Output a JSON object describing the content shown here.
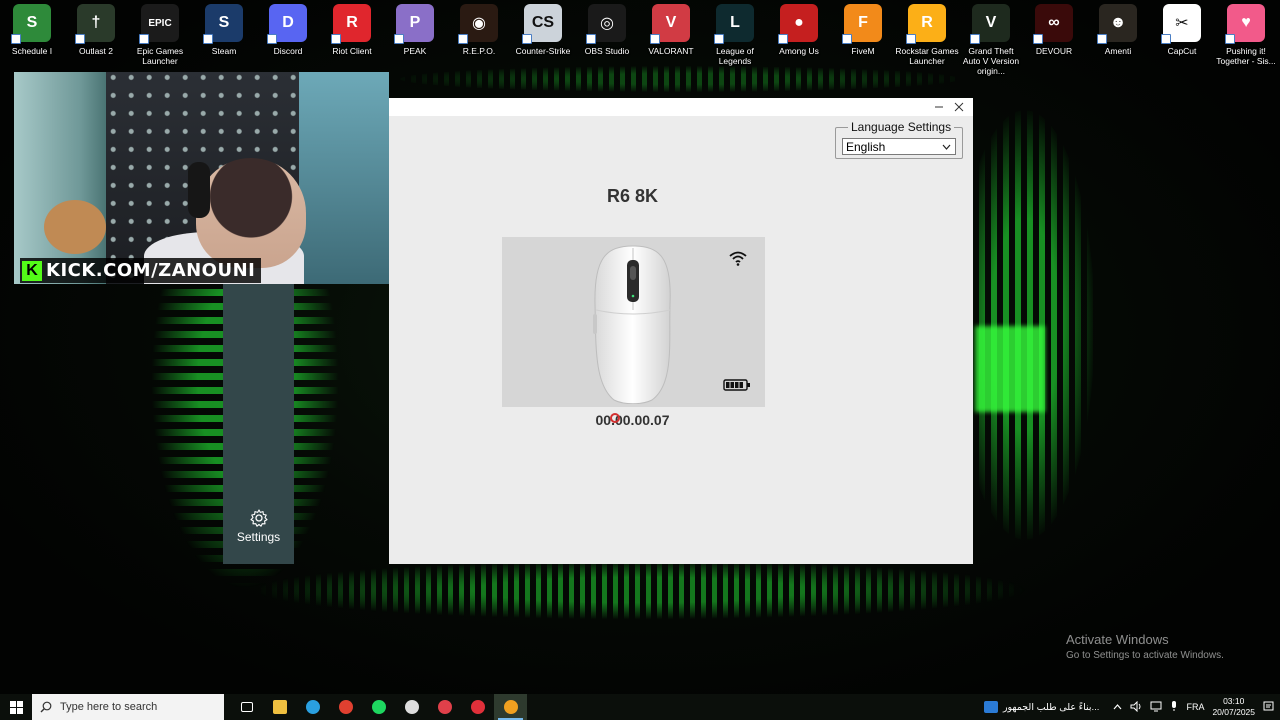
{
  "desktop": {
    "icons": [
      {
        "label": "Schedule I",
        "icon": "schedule-i-icon",
        "color": "#2e8a3a",
        "glyph": "S"
      },
      {
        "label": "Outlast 2",
        "icon": "outlast-2-icon",
        "color": "#2a3a2a",
        "glyph": "†"
      },
      {
        "label": "Epic Games Launcher",
        "icon": "epic-games-icon",
        "color": "#1b1b1b",
        "glyph": "EPIC"
      },
      {
        "label": "Steam",
        "icon": "steam-icon",
        "color": "#1b3b6a",
        "glyph": "S"
      },
      {
        "label": "Discord",
        "icon": "discord-icon",
        "color": "#5865f2",
        "glyph": "D"
      },
      {
        "label": "Riot Client",
        "icon": "riot-client-icon",
        "color": "#e0262d",
        "glyph": "R"
      },
      {
        "label": "PEAK",
        "icon": "peak-icon",
        "color": "#8a6fc8",
        "glyph": "P"
      },
      {
        "label": "R.E.P.O.",
        "icon": "repo-icon",
        "color": "#2a1a12",
        "glyph": "◉"
      },
      {
        "label": "Counter-Strike",
        "icon": "counter-strike-icon",
        "color": "#ccd3da",
        "glyph": "CS"
      },
      {
        "label": "OBS Studio",
        "icon": "obs-studio-icon",
        "color": "#1a1a1a",
        "glyph": "◎"
      },
      {
        "label": "VALORANT",
        "icon": "valorant-icon",
        "color": "#d13b44",
        "glyph": "V"
      },
      {
        "label": "League of Legends",
        "icon": "league-of-legends-icon",
        "color": "#0e2a2f",
        "glyph": "L"
      },
      {
        "label": "Among Us",
        "icon": "among-us-icon",
        "color": "#c51f1f",
        "glyph": "●"
      },
      {
        "label": "FiveM",
        "icon": "fivem-icon",
        "color": "#f28a1a",
        "glyph": "F"
      },
      {
        "label": "Rockstar Games Launcher",
        "icon": "rockstar-icon",
        "color": "#fcaf17",
        "glyph": "R"
      },
      {
        "label": "Grand Theft Auto V Version origin...",
        "icon": "gta-v-icon",
        "color": "#1e2a1e",
        "glyph": "V"
      },
      {
        "label": "DEVOUR",
        "icon": "devour-icon",
        "color": "#3a0a0a",
        "glyph": "∞"
      },
      {
        "label": "Amenti",
        "icon": "amenti-icon",
        "color": "#2a2620",
        "glyph": "☻"
      },
      {
        "label": "CapCut",
        "icon": "capcut-icon",
        "color": "#ffffff",
        "glyph": "✂"
      },
      {
        "label": "Pushing it! Together - Sis...",
        "icon": "pushing-it-icon",
        "color": "#f25a8a",
        "glyph": "♥"
      }
    ],
    "watermark": {
      "line1": "Activate Windows",
      "line2": "Go to Settings to activate Windows."
    }
  },
  "webcam": {
    "banner_text": "KICK.COM/ZANOUNI",
    "brand_color": "#53fc18"
  },
  "app": {
    "language_settings_label": "Language Settings",
    "language_value": "English",
    "device_name": "R6 8K",
    "firmware_version": "00.00.00.07",
    "sidebar_settings_label": "Settings",
    "sidebar_color": "#33474a"
  },
  "taskbar": {
    "search_placeholder": "Type here to search",
    "apps": [
      "task-view-icon",
      "file-explorer-icon",
      "edge-icon",
      "chrome-icon",
      "spotify-icon",
      "obs-icon",
      "valorant-icon",
      "riot-icon",
      "mouse-software-icon"
    ],
    "news_text": "بناءً على طلب الجمهور...",
    "language": "FRA",
    "time": "03:10",
    "date": "20/07/2025"
  }
}
